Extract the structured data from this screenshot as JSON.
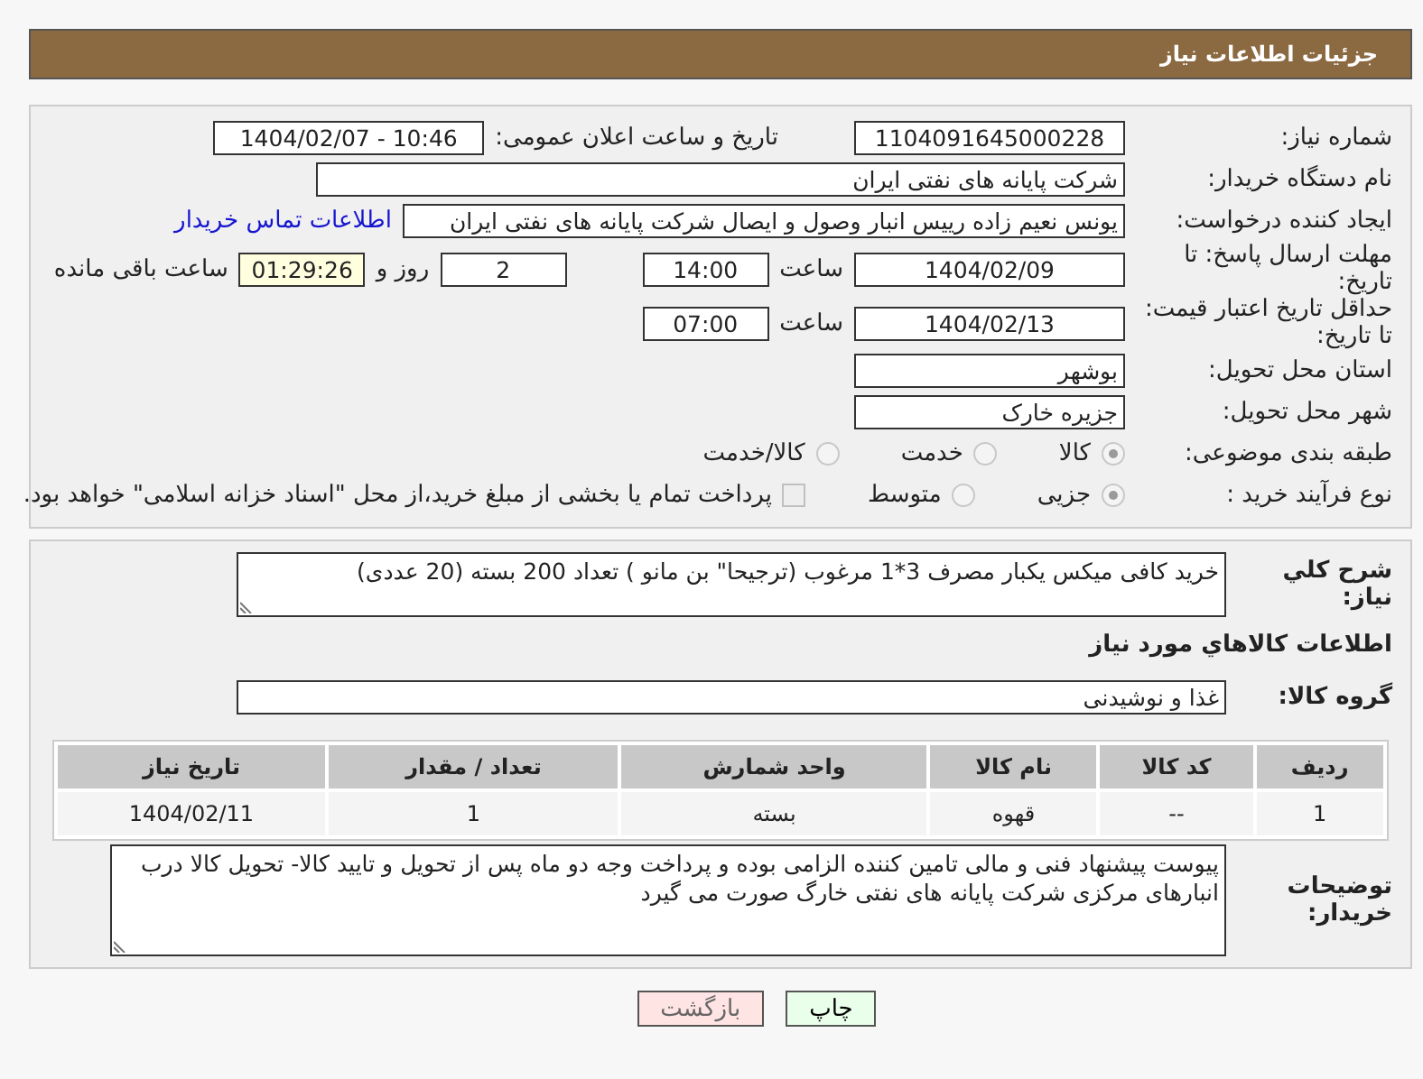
{
  "header": {
    "title": "جزئیات اطلاعات نیاز"
  },
  "need_number": {
    "label": "شماره نیاز:",
    "value": "1104091645000228"
  },
  "announcement": {
    "label": "تاریخ و ساعت اعلان عمومی:",
    "value": "1404/02/07 - 10:46"
  },
  "buyer_org": {
    "label": "نام دستگاه خریدار:",
    "value": "شرکت پایانه های نفتی ایران"
  },
  "requester": {
    "label": "ایجاد کننده درخواست:",
    "value": "یونس نعیم زاده رییس انبار وصول و ایصال شرکت پایانه های نفتی ایران",
    "link": "اطلاعات تماس خریدار"
  },
  "response_deadline": {
    "label": "مهلت ارسال پاسخ: تا تاریخ:",
    "date": "1404/02/09",
    "time_label": "ساعت",
    "time": "14:00",
    "days": "2",
    "days_label": "روز و",
    "remaining": "01:29:26",
    "remaining_label": "ساعت باقی مانده"
  },
  "price_validity": {
    "label": "حداقل تاریخ اعتبار قیمت: تا تاریخ:",
    "date": "1404/02/13",
    "time_label": "ساعت",
    "time": "07:00"
  },
  "province": {
    "label": "استان محل تحویل:",
    "value": "بوشهر"
  },
  "city": {
    "label": "شهر محل تحویل:",
    "value": "جزیره خارک"
  },
  "category": {
    "label": "طبقه بندی موضوعی:",
    "options": [
      {
        "label": "کالا",
        "selected": true
      },
      {
        "label": "خدمت",
        "selected": false
      },
      {
        "label": "کالا/خدمت",
        "selected": false
      }
    ]
  },
  "process_type": {
    "label": "نوع فرآیند خرید :",
    "options": [
      {
        "label": "جزیی",
        "selected": true
      },
      {
        "label": "متوسط",
        "selected": false
      }
    ],
    "payment": {
      "checked": false,
      "text": "پرداخت تمام یا بخشی از مبلغ خرید،از محل \"اسناد خزانه اسلامی\" خواهد بود."
    }
  },
  "description": {
    "label": "شرح کلي نياز:",
    "value": "خرید کافی میکس یکبار مصرف 3*1  مرغوب (ترجیحا\" بن مانو ) تعداد 200 بسته (20 عددی)"
  },
  "goods_heading": "اطلاعات كالاهاي مورد نياز",
  "goods_group": {
    "label": "گروه کالا:",
    "value": "غذا و نوشیدنی"
  },
  "table": {
    "columns": [
      "ردیف",
      "کد کالا",
      "نام کالا",
      "واحد شمارش",
      "تعداد / مقدار",
      "تاریخ نیاز"
    ],
    "rows": [
      [
        "1",
        "--",
        "قهوه",
        "بسته",
        "1",
        "1404/02/11"
      ]
    ]
  },
  "buyer_notes": {
    "label": "توضیحات خریدار:",
    "value": "پیوست پیشنهاد فنی و مالی تامین کننده الزامی بوده و پرداخت وجه دو ماه پس از تحویل و تایید کالا- تحویل کالا درب انبارهای مرکزی شرکت پایانه های نفتی خارگ صورت می گیرد"
  },
  "buttons": [
    {
      "label": "چاپ",
      "kind": "print"
    },
    {
      "label": "بازگشت",
      "kind": "back"
    }
  ]
}
